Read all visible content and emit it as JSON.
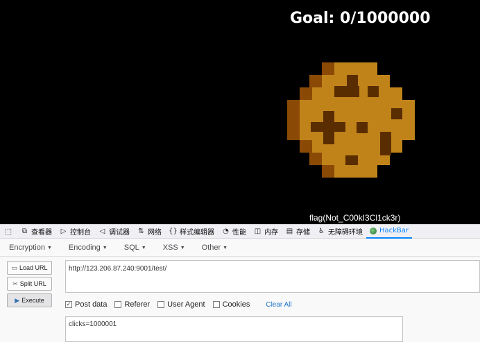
{
  "game": {
    "goal_text": "Goal: 0/1000000",
    "flag_text": "flag(Not_C00kI3Cl1ck3r)"
  },
  "devtools": {
    "tabs": [
      {
        "label": "查看器",
        "icon": "inspector-icon"
      },
      {
        "label": "控制台",
        "icon": "console-icon"
      },
      {
        "label": "调试器",
        "icon": "debugger-icon"
      },
      {
        "label": "网络",
        "icon": "network-icon"
      },
      {
        "label": "样式编辑器",
        "icon": "style-editor-icon"
      },
      {
        "label": "性能",
        "icon": "performance-icon"
      },
      {
        "label": "内存",
        "icon": "memory-icon"
      },
      {
        "label": "存储",
        "icon": "storage-icon"
      },
      {
        "label": "无障碍环境",
        "icon": "accessibility-icon"
      },
      {
        "label": "HackBar",
        "icon": "hackbar-icon"
      }
    ],
    "active_tab": "HackBar"
  },
  "hackbar": {
    "menus": [
      "Encryption",
      "Encoding",
      "SQL",
      "XSS",
      "Other"
    ],
    "buttons": {
      "load_url": "Load URL",
      "split_url": "Split URL",
      "execute": "Execute"
    },
    "url": "http://123.206.87.240:9001/test/",
    "options": [
      {
        "label": "Post data",
        "checked": true
      },
      {
        "label": "Referer",
        "checked": false
      },
      {
        "label": "User Agent",
        "checked": false
      },
      {
        "label": "Cookies",
        "checked": false
      }
    ],
    "clear_all": "Clear All",
    "post_data": "clicks=1000001"
  },
  "colors": {
    "cookie_light": "#c0831a",
    "cookie_dark": "#5a2d00",
    "cookie_mid": "#8a4a06",
    "active_tab": "#0a84ff",
    "link": "#1a73c8"
  }
}
